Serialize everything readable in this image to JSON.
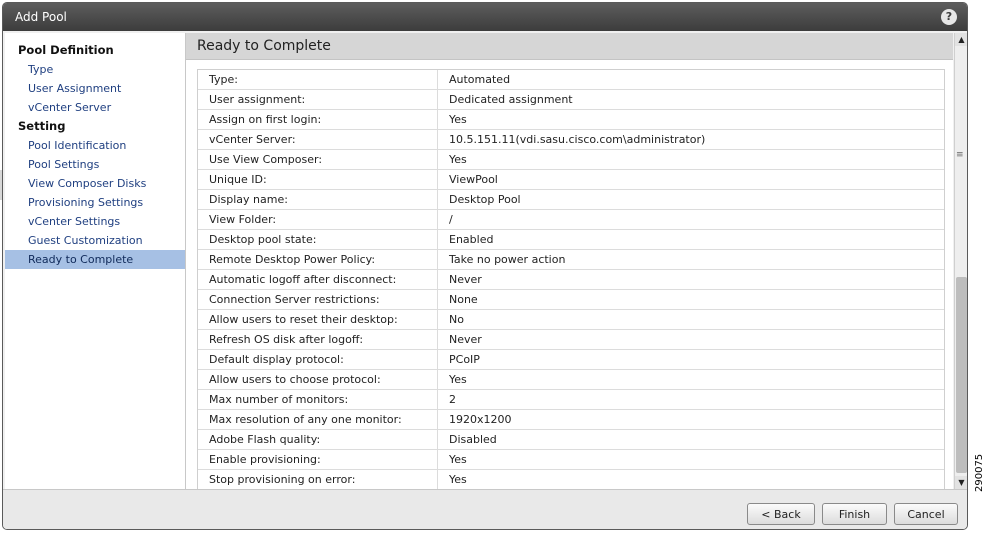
{
  "window": {
    "title": "Add Pool"
  },
  "sidebar": {
    "sections": [
      {
        "heading": "Pool Definition",
        "items": [
          "Type",
          "User Assignment",
          "vCenter Server"
        ]
      },
      {
        "heading": "Setting",
        "items": [
          "Pool Identification",
          "Pool Settings",
          "View Composer Disks",
          "Provisioning Settings",
          "vCenter Settings",
          "Guest Customization",
          "Ready to Complete"
        ]
      }
    ],
    "active_item": "Ready to Complete"
  },
  "main": {
    "title": "Ready to Complete",
    "rows": [
      [
        "Type:",
        "Automated"
      ],
      [
        "User assignment:",
        "Dedicated assignment"
      ],
      [
        "Assign on first login:",
        "Yes"
      ],
      [
        "vCenter Server:",
        "10.5.151.11(vdi.sasu.cisco.com\\administrator)"
      ],
      [
        "Use View Composer:",
        "Yes"
      ],
      [
        "Unique ID:",
        "ViewPool"
      ],
      [
        "Display name:",
        "Desktop Pool"
      ],
      [
        "View Folder:",
        "/"
      ],
      [
        "Desktop pool state:",
        "Enabled"
      ],
      [
        "Remote Desktop Power Policy:",
        "Take no power action"
      ],
      [
        "Automatic logoff after disconnect:",
        "Never"
      ],
      [
        "Connection Server restrictions:",
        "None"
      ],
      [
        "Allow users to reset their desktop:",
        "No"
      ],
      [
        "Refresh OS disk after logoff:",
        "Never"
      ],
      [
        "Default display protocol:",
        "PCoIP"
      ],
      [
        "Allow users to choose protocol:",
        "Yes"
      ],
      [
        "Max number of monitors:",
        "2"
      ],
      [
        "Max resolution of any one monitor:",
        "1920x1200"
      ],
      [
        "Adobe Flash quality:",
        "Disabled"
      ],
      [
        "Enable provisioning:",
        "Yes"
      ],
      [
        "Stop provisioning on error:",
        "Yes"
      ]
    ]
  },
  "footer": {
    "back_label": "< Back",
    "finish_label": "Finish",
    "cancel_label": "Cancel"
  },
  "figure_label": "290075",
  "icons": {
    "help": "help-icon",
    "scroll_up": "arrow-up-icon",
    "scroll_down": "arrow-down-icon"
  }
}
